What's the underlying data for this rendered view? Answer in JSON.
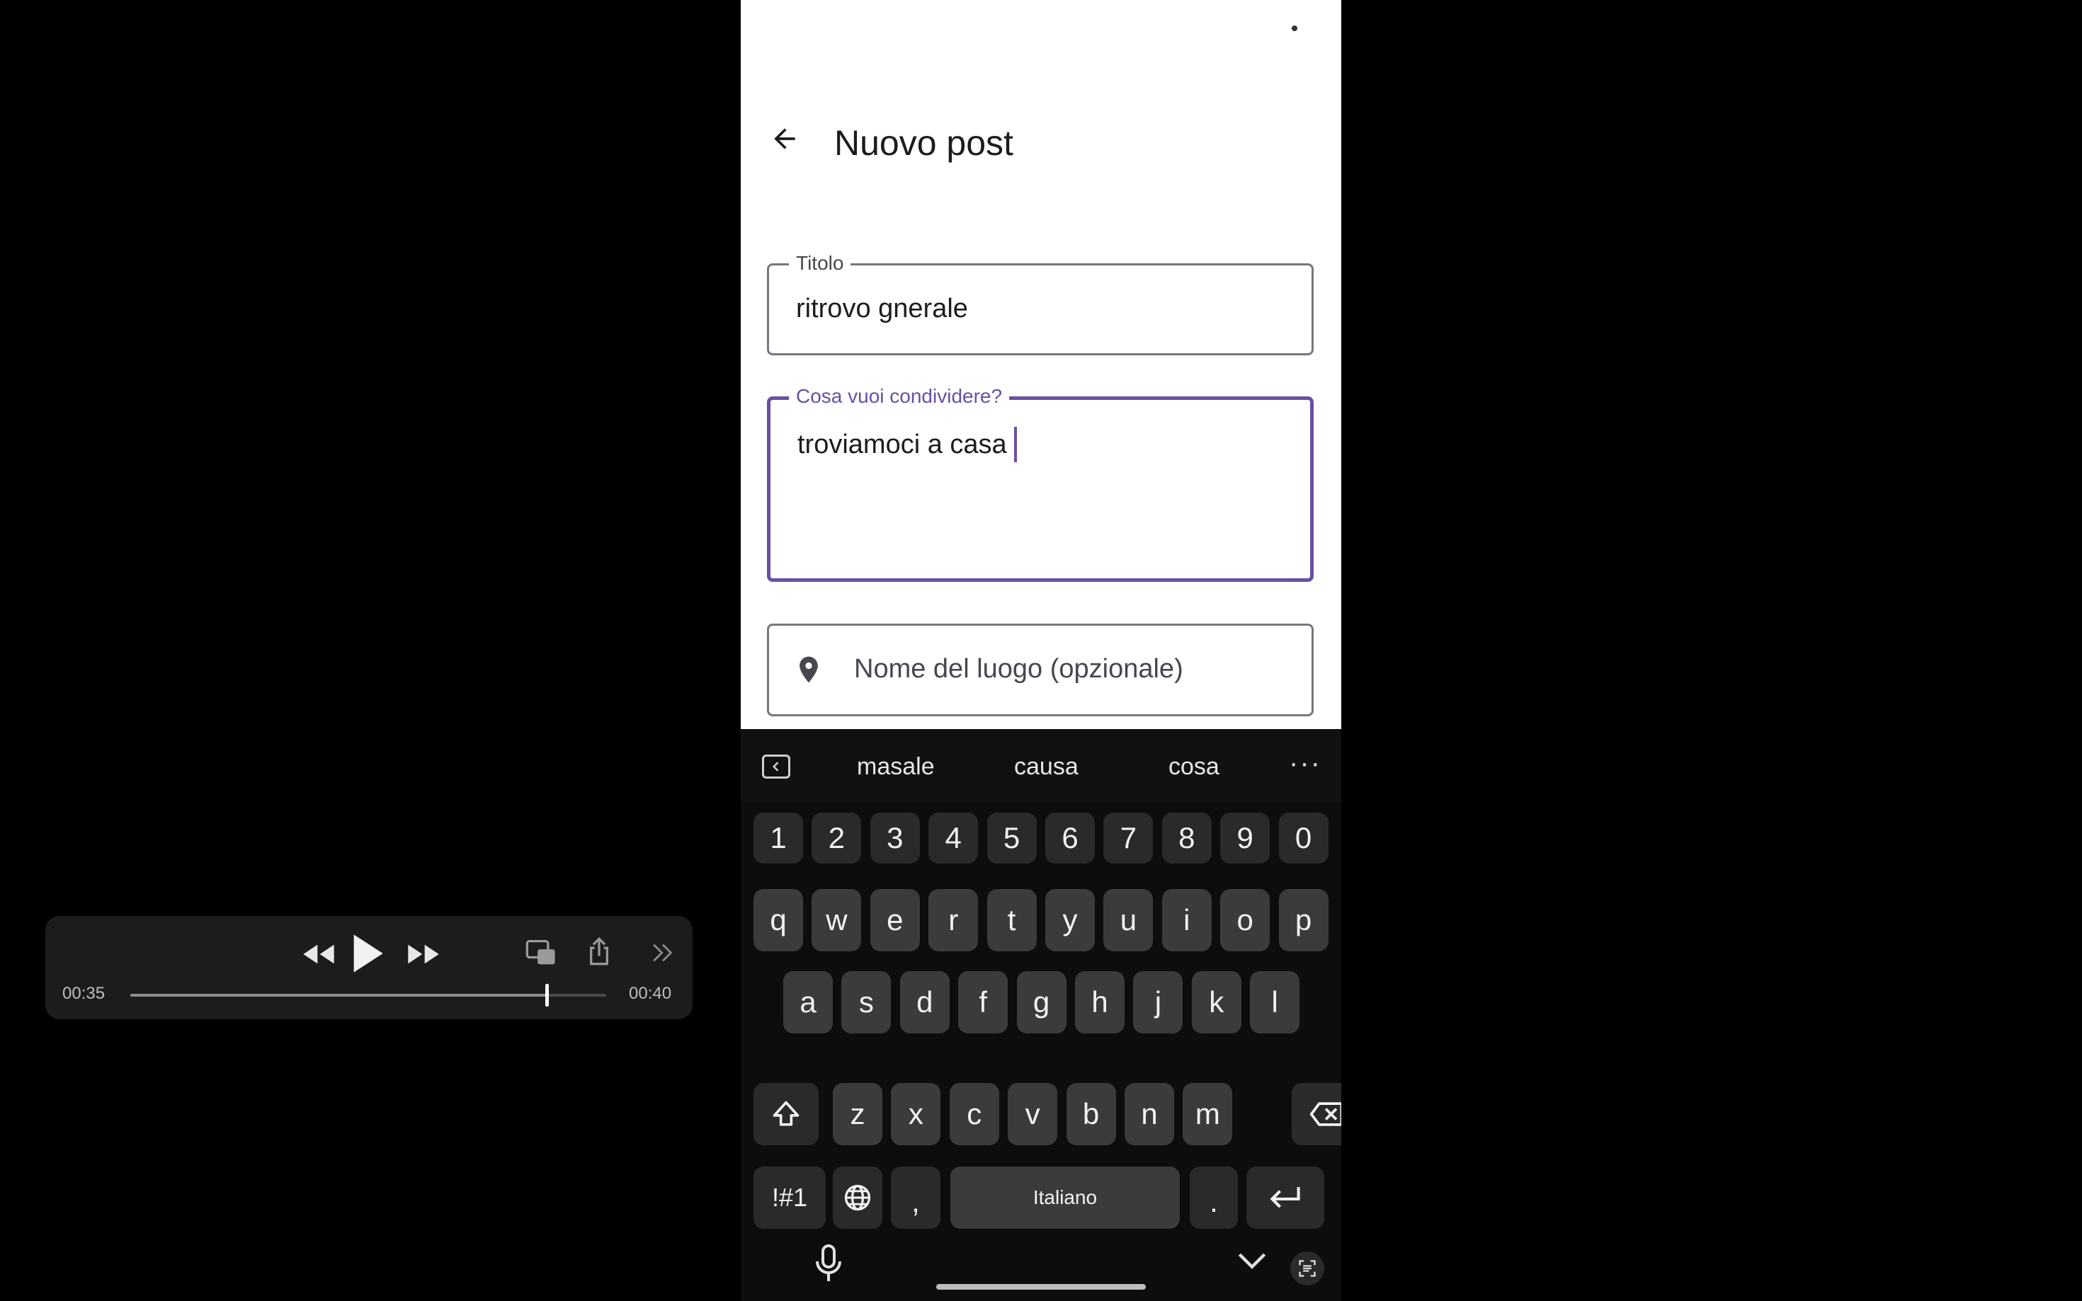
{
  "screen": {
    "title": "Nuovo post",
    "fields": {
      "title": {
        "label": "Titolo",
        "value": "ritrovo gnerale"
      },
      "body": {
        "label": "Cosa vuoi condividere?",
        "value": "troviamoci a casa"
      },
      "place": {
        "placeholder": "Nome del luogo (opzionale)"
      }
    }
  },
  "keyboard": {
    "suggestions": [
      "masale",
      "causa",
      "cosa"
    ],
    "rows": {
      "numbers": [
        "1",
        "2",
        "3",
        "4",
        "5",
        "6",
        "7",
        "8",
        "9",
        "0"
      ],
      "row1": [
        "q",
        "w",
        "e",
        "r",
        "t",
        "y",
        "u",
        "i",
        "o",
        "p"
      ],
      "row2": [
        "a",
        "s",
        "d",
        "f",
        "g",
        "h",
        "j",
        "k",
        "l"
      ],
      "row3": [
        "z",
        "x",
        "c",
        "v",
        "b",
        "n",
        "m"
      ]
    },
    "symbols_label": "!#1",
    "comma": ",",
    "period": ".",
    "space_label": "Italiano"
  },
  "player": {
    "elapsed": "00:35",
    "duration": "00:40",
    "progress": 0.875
  },
  "colors": {
    "accent": "#6750a4",
    "keyboard_bg": "#0d0d0d",
    "key_bg": "#3b3b3b",
    "player_bg": "#1c1c1e"
  },
  "icons": [
    "back-arrow-icon",
    "location-pin-icon",
    "collapse-suggestions-icon",
    "more-icon",
    "shift-icon",
    "backspace-icon",
    "globe-icon",
    "enter-icon",
    "mic-icon",
    "hide-keyboard-icon",
    "scan-text-icon",
    "rewind-icon",
    "play-icon",
    "fast-forward-icon",
    "picture-in-picture-icon",
    "share-icon",
    "expand-icon"
  ]
}
